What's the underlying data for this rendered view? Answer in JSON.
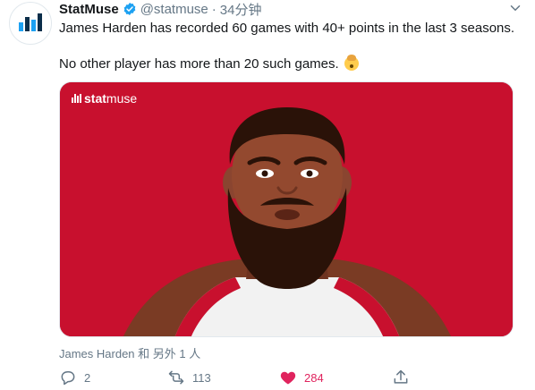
{
  "tweet": {
    "author_name": "StatMuse",
    "handle": "@statmuse",
    "separator": "·",
    "time": "34分钟",
    "line1": "James Harden has recorded 60 games with 40+ points in the last 3 seasons.",
    "line2": "No other player has more than 20 such games.",
    "emoji": "exploding-head"
  },
  "card": {
    "brand_bold": "stat",
    "brand_rest": "muse",
    "background": "#c8102e"
  },
  "context": "James Harden 和 另外 1 人",
  "actions": {
    "reply_count": "2",
    "retweet_count": "113",
    "like_count": "284",
    "like_color": "#e0245e"
  },
  "colors": {
    "accent": "#1da1f2",
    "muted": "#657786"
  }
}
